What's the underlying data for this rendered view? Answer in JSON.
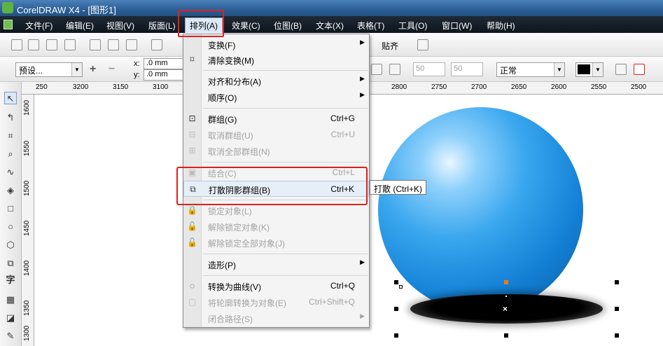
{
  "window": {
    "title": "CorelDRAW X4 - [图形1]"
  },
  "menubar": {
    "items": [
      "文件(F)",
      "编辑(E)",
      "视图(V)",
      "版面(L)",
      "排列(A)",
      "效果(C)",
      "位图(B)",
      "文本(X)",
      "表格(T)",
      "工具(O)",
      "窗口(W)",
      "帮助(H)"
    ],
    "active": "排列(A)"
  },
  "toolbar": {
    "snap_label": "贴齐"
  },
  "property_bar": {
    "preset": "预设...",
    "x_label": "x:",
    "x_value": ".0 mm",
    "y_label": "y:",
    "y_value": ".0 mm",
    "spin1": "50",
    "spin2": "50",
    "blend_mode": "正常"
  },
  "ruler": {
    "top": [
      "250",
      "3200",
      "3150",
      "3100",
      "2800",
      "2750",
      "2700",
      "2650",
      "2600",
      "2550",
      "2500"
    ],
    "left": [
      "1600",
      "1550",
      "1500",
      "1450",
      "1400",
      "1350",
      "1300"
    ]
  },
  "arrange_menu": {
    "items": [
      {
        "label": "变换(F)",
        "shortcut": "",
        "submenu": true,
        "disabled": false,
        "icon": "none"
      },
      {
        "label": "清除变换(M)",
        "shortcut": "",
        "submenu": false,
        "disabled": false,
        "icon": "clear-transform-icon"
      },
      {
        "label": "对齐和分布(A)",
        "shortcut": "",
        "submenu": true,
        "disabled": false,
        "icon": "none"
      },
      {
        "label": "顺序(O)",
        "shortcut": "",
        "submenu": true,
        "disabled": false,
        "icon": "none"
      },
      {
        "label": "群组(G)",
        "shortcut": "Ctrl+G",
        "submenu": false,
        "disabled": false,
        "icon": "group-icon"
      },
      {
        "label": "取消群组(U)",
        "shortcut": "Ctrl+U",
        "submenu": false,
        "disabled": true,
        "icon": "ungroup-icon"
      },
      {
        "label": "取消全部群组(N)",
        "shortcut": "",
        "submenu": false,
        "disabled": true,
        "icon": "ungroup-all-icon"
      },
      {
        "label": "结合(C)",
        "shortcut": "Ctrl+L",
        "submenu": false,
        "disabled": true,
        "icon": "combine-icon"
      },
      {
        "label": "打散阴影群组(B)",
        "shortcut": "Ctrl+K",
        "submenu": false,
        "disabled": false,
        "icon": "break-apart-icon"
      },
      {
        "label": "锁定对象(L)",
        "shortcut": "",
        "submenu": false,
        "disabled": true,
        "icon": "lock-icon"
      },
      {
        "label": "解除锁定对象(K)",
        "shortcut": "",
        "submenu": false,
        "disabled": true,
        "icon": "unlock-icon"
      },
      {
        "label": "解除锁定全部对象(J)",
        "shortcut": "",
        "submenu": false,
        "disabled": true,
        "icon": "unlock-all-icon"
      },
      {
        "label": "造形(P)",
        "shortcut": "",
        "submenu": true,
        "disabled": false,
        "icon": "none"
      },
      {
        "label": "转换为曲线(V)",
        "shortcut": "Ctrl+Q",
        "submenu": false,
        "disabled": false,
        "icon": "convert-curves-icon"
      },
      {
        "label": "将轮廓转换为对象(E)",
        "shortcut": "Ctrl+Shift+Q",
        "submenu": false,
        "disabled": true,
        "icon": "outline-object-icon"
      },
      {
        "label": "闭合路径(S)",
        "shortcut": "",
        "submenu": true,
        "disabled": true,
        "icon": "none"
      }
    ],
    "highlighted": "打散阴影群组(B)"
  },
  "tooltip": {
    "text": "打散 (Ctrl+K)"
  },
  "colors": {
    "sphere": "#1a8ae0",
    "highlight_box": "#e02020",
    "menubar": "#131c26"
  }
}
